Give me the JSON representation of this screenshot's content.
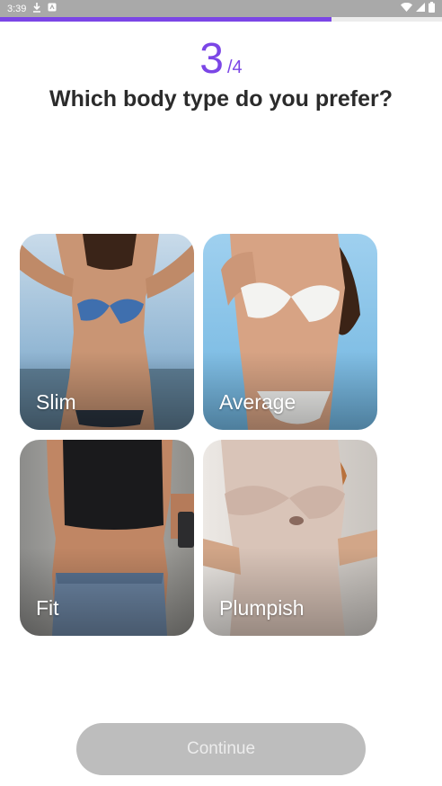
{
  "status_bar": {
    "time": "3:39",
    "icons": [
      "download-icon",
      "app-notification-icon",
      "wifi-icon",
      "signal-icon",
      "battery-icon"
    ]
  },
  "progress": {
    "fraction": 0.75,
    "color": "#7b46e6"
  },
  "step": {
    "current": "3",
    "total": "/4"
  },
  "question": "Which body type do you prefer?",
  "options": [
    {
      "label": "Slim"
    },
    {
      "label": "Average"
    },
    {
      "label": "Fit"
    },
    {
      "label": "Plumpish"
    }
  ],
  "continue_button": {
    "label": "Continue",
    "enabled": false
  }
}
